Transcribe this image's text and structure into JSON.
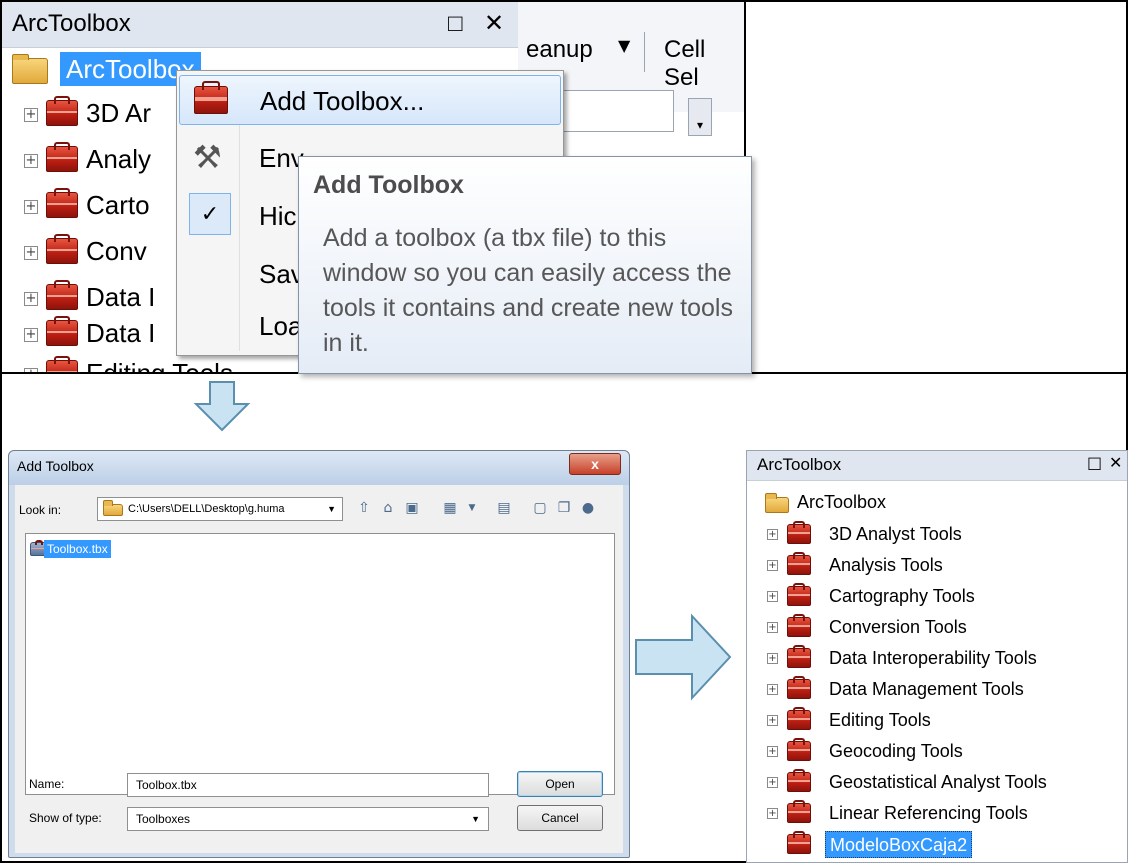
{
  "top_panel": {
    "title": "ArcToolbox",
    "maximize_glyph": "□",
    "close_glyph": "✕",
    "root_label": "ArcToolbox",
    "tree_items": [
      "3D Ar",
      "Analy",
      "Carto",
      "Conv",
      "Data I",
      "Data I",
      "Editing Tools"
    ],
    "toolbar": {
      "item1": "eanup",
      "item2": "Cell Sel"
    },
    "context_menu": [
      {
        "label": "Add Toolbox...",
        "icon": "toolbox-icon",
        "highlighted": true
      },
      {
        "label": "Env",
        "icon": "tools-icon"
      },
      {
        "label": "Hic",
        "icon": "check-icon",
        "checked": true
      },
      {
        "label": "Sav",
        "icon": ""
      },
      {
        "label": "Loa",
        "icon": ""
      }
    ],
    "tooltip": {
      "title": "Add Toolbox",
      "body": "Add a toolbox (a tbx file) to this window so you can easily access the tools it contains and create new tools in it."
    }
  },
  "dialog": {
    "title": "Add Toolbox",
    "close_glyph": "x",
    "look_in_label": "Look in:",
    "look_in_value": "C:\\Users\\DELL\\Desktop\\g.huma",
    "files": [
      "Toolbox.tbx"
    ],
    "name_label": "Name:",
    "name_value": "Toolbox.tbx",
    "type_label": "Show of type:",
    "type_value": "Toolboxes",
    "open_label": "Open",
    "cancel_label": "Cancel"
  },
  "result_panel": {
    "title": "ArcToolbox",
    "maximize_glyph": "□",
    "close_glyph": "✕",
    "root_label": "ArcToolbox",
    "tree_items": [
      "3D Analyst Tools",
      "Analysis Tools",
      "Cartography Tools",
      "Conversion Tools",
      "Data Interoperability Tools",
      "Data Management Tools",
      "Editing Tools",
      "Geocoding Tools",
      "Geostatistical Analyst Tools",
      "Linear Referencing Tools"
    ],
    "new_item": "ModeloBoxCaja2"
  },
  "colors": {
    "selection": "#3399ff",
    "arrow_fill": "#c9e3f3",
    "arrow_stroke": "#5a8fae",
    "toolbox_red": "#b81d12"
  }
}
